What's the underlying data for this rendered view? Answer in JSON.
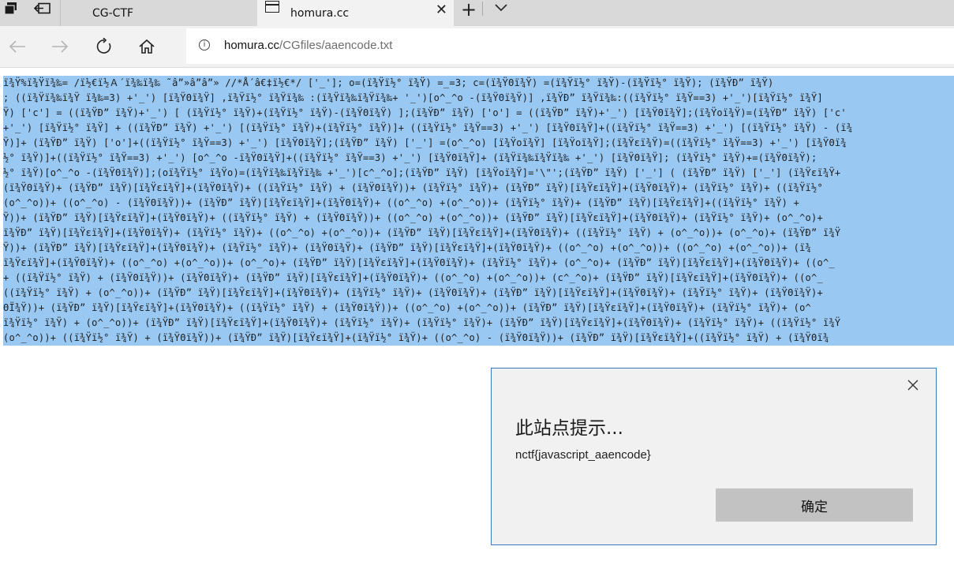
{
  "browser": {
    "tabs": [
      {
        "label": "CG-CTF",
        "active": false
      },
      {
        "label": "homura.cc",
        "active": true
      }
    ],
    "new_tab_icon": "plus-icon",
    "tab_list_icon": "chevron-down-icon",
    "address": {
      "host": "homura.cc",
      "path": "/CGfiles/aaencode.txt"
    }
  },
  "page": {
    "code_lines": [
      "ï¾Ÿ%ï¾Ÿï¾‰= /ï½€ï½Ａ´ï¾‰ï¾‰ ˜â”»â”â”» //*Å´â€‡ï½€*/ ['_']; o=(ï¾Ÿï½° ï¾Ÿ) =_=3; c=(ï¾ŸΘï¾Ÿ) =(ï¾Ÿï½° ï¾Ÿ)-(ï¾Ÿï½° ï¾Ÿ); (ï¾ŸÐ” ï¾Ÿ)",
      "; ((ï¾Ÿï¾‰ï¾Ÿ ï¾‰=3) +'_') [ï¾ŸΘï¾Ÿ] ,ï¾Ÿï½° ï¾Ÿï¾‰ :(ï¾Ÿï¾‰ï¾Ÿï¾‰+ '_')[o^_^o -(ï¾ŸΘï¾Ÿ)] ,ï¾ŸÐ” ï¾Ÿï¾‰:((ï¾Ÿï½° ï¾Ÿ==3) +'_')[ï¾Ÿï½° ï¾Ÿ]",
      "Ÿ) ['c'] = ((ï¾ŸÐ” ï¾Ÿ)+'_') [ (ï¾Ÿï½° ï¾Ÿ)+(ï¾Ÿï½° ï¾Ÿ)-(ï¾ŸΘï¾Ÿ) ];(ï¾ŸÐ” ï¾Ÿ) ['o'] = ((ï¾ŸÐ” ï¾Ÿ)+'_') [ï¾ŸΘï¾Ÿ];(ï¾Ÿoï¾Ÿ)=(ï¾ŸÐ” ï¾Ÿ) ['c'",
      "+'_') [ï¾Ÿï½° ï¾Ÿ] + ((ï¾ŸÐ” ï¾Ÿ) +'_') [(ï¾Ÿï½° ï¾Ÿ)+(ï¾Ÿï½° ï¾Ÿ)]+ ((ï¾Ÿï½° ï¾Ÿ==3) +'_') [ï¾ŸΘï¾Ÿ]+((ï¾Ÿï½° ï¾Ÿ==3) +'_') [(ï¾Ÿï½° ï¾Ÿ) - (ï¾",
      "Ÿ)]+ (ï¾ŸÐ” ï¾Ÿ) ['o']+((ï¾Ÿï½° ï¾Ÿ==3) +'_') [ï¾ŸΘï¾Ÿ];(ï¾ŸÐ” ï¾Ÿ) ['_'] =(o^_^o) [ï¾Ÿoï¾Ÿ] [ï¾Ÿoï¾Ÿ];(ï¾Ÿεï¾Ÿ)=((ï¾Ÿï½° ï¾Ÿ==3) +'_') [ï¾ŸΘï¾",
      "½° ï¾Ÿ)]+((ï¾Ÿï½° ï¾Ÿ==3) +'_') [o^_^o -ï¾ŸΘï¾Ÿ]+((ï¾Ÿï½° ï¾Ÿ==3) +'_') [ï¾ŸΘï¾Ÿ]+ (ï¾Ÿï¾‰ï¾Ÿï¾‰ +'_') [ï¾ŸΘï¾Ÿ]; (ï¾Ÿï½° ï¾Ÿ)+=(ï¾ŸΘï¾Ÿ);",
      "½° ï¾Ÿ)[o^_^o -(ï¾ŸΘï¾Ÿ)];(oï¾Ÿï½° ï¾Ÿo)=(ï¾Ÿï¾‰ï¾Ÿï¾‰ +'_')[c^_^o];(ï¾ŸÐ” ï¾Ÿ) [ï¾Ÿoï¾Ÿ]='\\\"';(ï¾ŸÐ” ï¾Ÿ) ['_'] ( (ï¾ŸÐ” ï¾Ÿ) ['_'] (ï¾Ÿεï¾Ÿ+",
      "(ï¾ŸΘï¾Ÿ)+ (ï¾ŸÐ” ï¾Ÿ)[ï¾Ÿεï¾Ÿ]+(ï¾ŸΘï¾Ÿ)+ ((ï¾Ÿï½° ï¾Ÿ) + (ï¾ŸΘï¾Ÿ))+ (ï¾Ÿï½° ï¾Ÿ)+ (ï¾ŸÐ” ï¾Ÿ)[ï¾Ÿεï¾Ÿ]+(ï¾ŸΘï¾Ÿ)+ (ï¾Ÿï½° ï¾Ÿ)+ ((ï¾Ÿï½°",
      "(o^_^o))+ ((o^_^o) - (ï¾ŸΘï¾Ÿ))+ (ï¾ŸÐ” ï¾Ÿ)[ï¾Ÿεï¾Ÿ]+(ï¾ŸΘï¾Ÿ)+ ((o^_^o) +(o^_^o))+ (ï¾Ÿï½° ï¾Ÿ)+ (ï¾ŸÐ” ï¾Ÿ)[ï¾Ÿεï¾Ÿ]+((ï¾Ÿï½° ï¾Ÿ) +",
      "Ÿ))+ (ï¾ŸÐ” ï¾Ÿ)[ï¾Ÿεï¾Ÿ]+(ï¾ŸΘï¾Ÿ)+ ((ï¾Ÿï½° ï¾Ÿ) + (ï¾ŸΘï¾Ÿ))+ ((o^_^o) +(o^_^o))+ (ï¾ŸÐ” ï¾Ÿ)[ï¾Ÿεï¾Ÿ]+(ï¾ŸΘï¾Ÿ)+ (ï¾Ÿï½° ï¾Ÿ)+ (o^_^o)+",
      "ï¾ŸÐ” ï¾Ÿ)[ï¾Ÿεï¾Ÿ]+(ï¾ŸΘï¾Ÿ)+ (ï¾Ÿï½° ï¾Ÿ)+ ((o^_^o) +(o^_^o))+ (ï¾ŸÐ” ï¾Ÿ)[ï¾Ÿεï¾Ÿ]+(ï¾ŸΘï¾Ÿ)+ ((ï¾Ÿï½° ï¾Ÿ) + (o^_^o))+ (o^_^o)+ (ï¾ŸÐ” ï¾Ÿ",
      "Ÿ))+ (ï¾ŸÐ” ï¾Ÿ)[ï¾Ÿεï¾Ÿ]+(ï¾ŸΘï¾Ÿ)+ (ï¾Ÿï½° ï¾Ÿ)+ (ï¾ŸΘï¾Ÿ)+ (ï¾ŸÐ” ï¾Ÿ)[ï¾Ÿεï¾Ÿ]+(ï¾ŸΘï¾Ÿ)+ ((o^_^o) +(o^_^o))+ ((o^_^o) +(o^_^o))+ (ï¾",
      "ï¾Ÿεï¾Ÿ]+(ï¾ŸΘï¾Ÿ)+ ((o^_^o) +(o^_^o))+ (o^_^o)+ (ï¾ŸÐ” ï¾Ÿ)[ï¾Ÿεï¾Ÿ]+(ï¾ŸΘï¾Ÿ)+ (ï¾Ÿï½° ï¾Ÿ)+ (o^_^o)+ (ï¾ŸÐ” ï¾Ÿ)[ï¾Ÿεï¾Ÿ]+(ï¾ŸΘï¾Ÿ)+ ((o^_",
      "+ ((ï¾Ÿï½° ï¾Ÿ) + (ï¾ŸΘï¾Ÿ))+ (ï¾ŸΘï¾Ÿ)+ (ï¾ŸÐ” ï¾Ÿ)[ï¾Ÿεï¾Ÿ]+(ï¾ŸΘï¾Ÿ)+ ((o^_^o) +(o^_^o))+ (c^_^o)+ (ï¾ŸÐ” ï¾Ÿ)[ï¾Ÿεï¾Ÿ]+(ï¾ŸΘï¾Ÿ)+ ((o^_",
      "((ï¾Ÿï½° ï¾Ÿ) + (o^_^o))+ (ï¾ŸÐ” ï¾Ÿ)[ï¾Ÿεï¾Ÿ]+(ï¾ŸΘï¾Ÿ)+ (ï¾Ÿï½° ï¾Ÿ)+ (ï¾ŸΘï¾Ÿ)+ (ï¾ŸÐ” ï¾Ÿ)[ï¾Ÿεï¾Ÿ]+(ï¾ŸΘï¾Ÿ)+ (ï¾Ÿï½° ï¾Ÿ)+ (ï¾ŸΘï¾Ÿ)+",
      "ΘÏ¾Ÿ))+ (ï¾ŸÐ” ï¾Ÿ)[ï¾Ÿεï¾Ÿ]+(ï¾ŸΘï¾Ÿ)+ ((ï¾Ÿï½° ï¾Ÿ) + (ï¾ŸΘï¾Ÿ))+ ((o^_^o) +(o^_^o))+ (ï¾ŸÐ” ï¾Ÿ)[ï¾Ÿεï¾Ÿ]+(ï¾ŸΘï¾Ÿ)+ (ï¾Ÿï½° ï¾Ÿ)+ (o^",
      "ï¾Ÿï½° ï¾Ÿ) + (o^_^o))+ (ï¾ŸÐ” ï¾Ÿ)[ï¾Ÿεï¾Ÿ]+(ï¾ŸΘï¾Ÿ)+ (ï¾Ÿï½° ï¾Ÿ)+ (ï¾Ÿï½° ï¾Ÿ)+ (ï¾ŸÐ” ï¾Ÿ)[ï¾Ÿεï¾Ÿ]+(ï¾ŸΘï¾Ÿ)+ (ï¾Ÿï½° ï¾Ÿ)+ ((ï¾Ÿï½° ï¾Ÿ",
      "(o^_^o))+ ((ï¾Ÿï½° ï¾Ÿ) + (ï¾ŸΘï¾Ÿ))+ (ï¾ŸÐ” ï¾Ÿ)[ï¾Ÿεï¾Ÿ]+(ï¾Ÿï½° ï¾Ÿ)+ ((o^_^o) - (ï¾ŸΘï¾Ÿ))+ (ï¾ŸÐ” ï¾Ÿ)[ï¾Ÿεï¾Ÿ]+((ï¾Ÿï½° ï¾Ÿ) + (ï¾ŸΘï¾"
    ]
  },
  "dialog": {
    "title": "此站点提示...",
    "message": "nctf{javascript_aaencode}",
    "ok_label": "确定",
    "close_icon": "close-icon"
  }
}
